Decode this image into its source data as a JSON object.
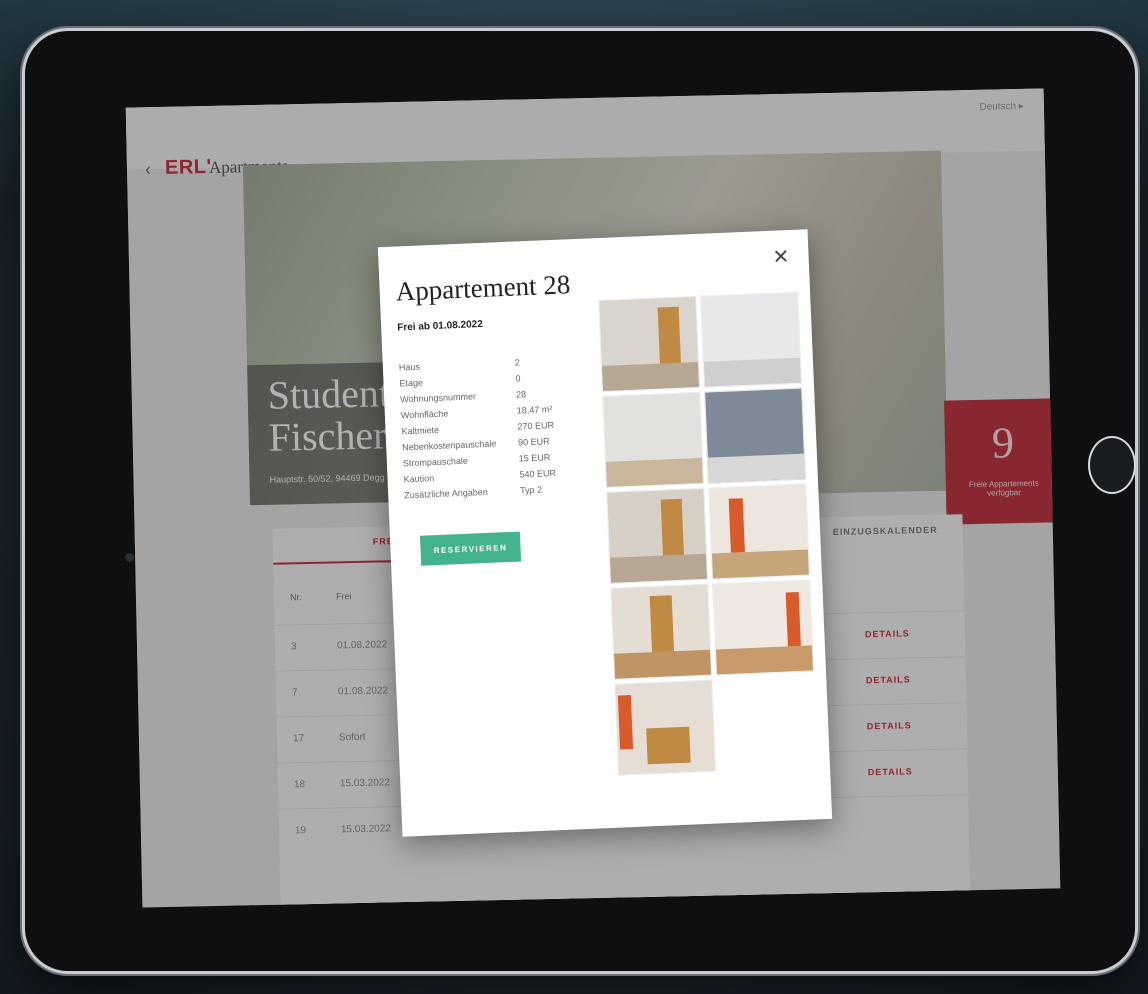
{
  "app": {
    "logo": "ERL'",
    "brand": "Apartments",
    "back_icon": "‹",
    "language": "Deutsch ▸"
  },
  "hero": {
    "title_line1": "Student",
    "title_line2": "Fischer",
    "address": "Hauptstr. 50/52, 94469 Degg",
    "count_value": "9",
    "count_label": "Freie Appartements verfügbar"
  },
  "listing": {
    "tab_free": "FREI",
    "tab_calendar": "EINZUGSKALENDER",
    "col_nr": "Nr.",
    "col_free": "Frei",
    "details_label": "DETAILS",
    "rows": [
      {
        "nr": "3",
        "free": "01.08.2022"
      },
      {
        "nr": "7",
        "free": "01.08.2022"
      },
      {
        "nr": "17",
        "free": "Sofort"
      },
      {
        "nr": "18",
        "free": "15.03.2022"
      },
      {
        "nr": "19",
        "free": "15.03.2022"
      }
    ]
  },
  "modal": {
    "title": "Appartement 28",
    "close_icon": "✕",
    "free_from": "Frei ab 01.08.2022",
    "attributes": [
      {
        "label": "Haus",
        "value": "2"
      },
      {
        "label": "Etage",
        "value": "0"
      },
      {
        "label": "Wohnungsnummer",
        "value": "28"
      },
      {
        "label": "Wohnfläche",
        "value": "18,47 m²"
      },
      {
        "label": "Kaltmiete",
        "value": "270 EUR"
      },
      {
        "label": "Nebenkostenpauschale",
        "value": "90 EUR"
      },
      {
        "label": "Strompauschale",
        "value": "15 EUR"
      },
      {
        "label": "Kaution",
        "value": "540 EUR"
      },
      {
        "label": "Zusätzliche Angaben",
        "value": "Typ 2"
      }
    ],
    "reserve_label": "RESERVIEREN",
    "photo_count": 9
  },
  "colors": {
    "brand_red": "#c0172a",
    "reserve_green": "#43b38c"
  }
}
